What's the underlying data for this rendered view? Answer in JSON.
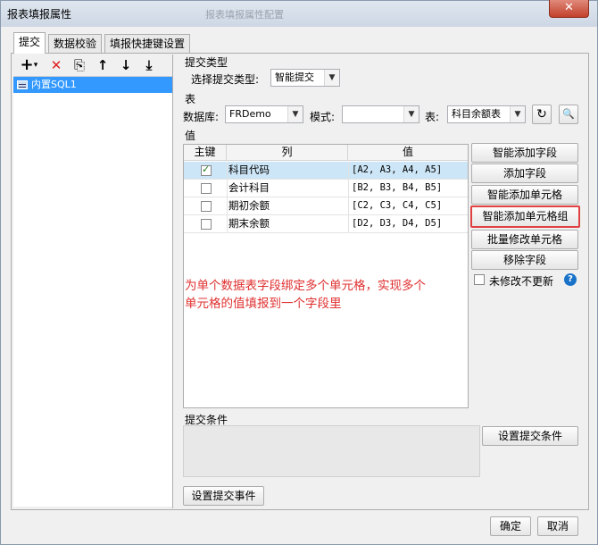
{
  "window": {
    "title": "报表填报属性",
    "ghost_title": "报表填报属性配置",
    "close_glyph": "✕"
  },
  "tabs": [
    {
      "label": "提交"
    },
    {
      "label": "数据校验"
    },
    {
      "label": "填报快捷键设置"
    }
  ],
  "toolbar": {
    "add_icon": "plus-icon",
    "add_glyph": "+",
    "dropdown_glyph": "▾",
    "delete_glyph": "✕",
    "copy_glyph": "⎘",
    "up_glyph": "↑",
    "down_glyph": "↓",
    "bottom_glyph": "⤓"
  },
  "tree": {
    "items": [
      {
        "label": "内置SQL1"
      }
    ]
  },
  "submit_type": {
    "group_label": "提交类型",
    "select_label": "选择提交类型:",
    "value": "智能提交"
  },
  "table_section": {
    "group_label": "表",
    "db_label": "数据库:",
    "db_value": "FRDemo",
    "schema_label": "模式:",
    "schema_value": "",
    "table_label": "表:",
    "table_value": "科目余额表",
    "refresh_glyph": "↻",
    "preview_glyph": "🔍"
  },
  "values_section": {
    "group_label": "值",
    "columns": [
      "主键",
      "列",
      "值"
    ],
    "rows": [
      {
        "key": true,
        "column": "科目代码",
        "value": "[A2, A3, A4, A5]"
      },
      {
        "key": false,
        "column": "会计科目",
        "value": "[B2, B3, B4, B5]"
      },
      {
        "key": false,
        "column": "期初余额",
        "value": "[C2, C3, C4, C5]"
      },
      {
        "key": false,
        "column": "期末余额",
        "value": "[D2, D3, D4, D5]"
      }
    ],
    "buttons": {
      "smart_add_field": "智能添加字段",
      "add_field": "添加字段",
      "smart_add_cell": "智能添加单元格",
      "smart_add_cell_group": "智能添加单元格组",
      "batch_modify_cell": "批量修改单元格",
      "remove_field": "移除字段"
    },
    "no_update_label": "未修改不更新",
    "help_glyph": "?",
    "annotation_line1": "为单个数据表字段绑定多个单元格，实现多个",
    "annotation_line2": "单元格的值填报到一个字段里"
  },
  "submit_condition": {
    "group_label": "提交条件",
    "button": "设置提交条件"
  },
  "submit_event_button": "设置提交事件",
  "dialog": {
    "ok": "确定",
    "cancel": "取消"
  },
  "colors": {
    "selection": "#3399ff",
    "annotation": "#e03030",
    "highlight_border": "#e04040"
  }
}
